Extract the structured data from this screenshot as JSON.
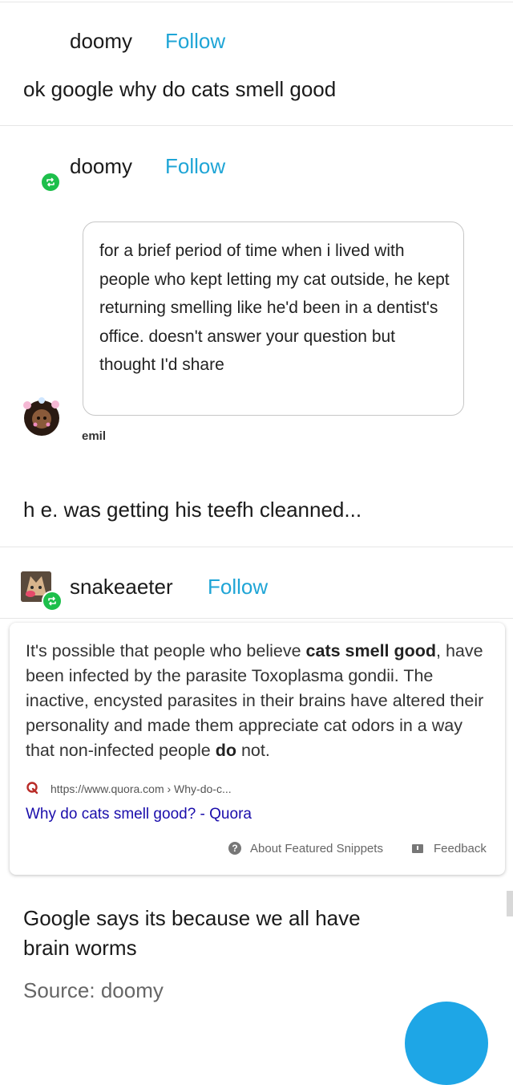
{
  "post1": {
    "username": "doomy",
    "follow": "Follow",
    "text": "ok google why do cats smell good"
  },
  "reblog1": {
    "username": "doomy",
    "follow": "Follow",
    "ask": {
      "text": "for a brief period of time when i lived with people who kept letting my cat outside, he kept returning smelling like he'd been in a dentist's office. doesn't answer your question but thought I'd share",
      "asker": "emil"
    },
    "answer": "h e. was getting his teefh cleanned..."
  },
  "reblog2": {
    "username": "snakeaeter",
    "follow": "Follow",
    "snippet": {
      "text_before": "It's possible that people who believe ",
      "text_bold1": "cats smell good",
      "text_mid": ", have been infected by the parasite Toxoplasma gondii. The inactive, encysted parasites in their brains have altered their personality and made them appreciate cat odors in a way that non-infected people ",
      "text_bold2": "do",
      "text_after": " not.",
      "source_url": "https://www.quora.com › Why-do-c...",
      "link_title": "Why do cats smell good? - Quora",
      "about": "About Featured Snippets",
      "feedback": "Feedback"
    },
    "caption_line1": "Google says its because we all have",
    "caption_line2": "brain worms"
  },
  "source": "Source: doomy",
  "colors": {
    "follow": "#1fa5d6",
    "reblog_badge": "#1dbf4b",
    "link": "#1a0dab",
    "quora": "#b92b27",
    "fab": "#1ea6e6"
  }
}
